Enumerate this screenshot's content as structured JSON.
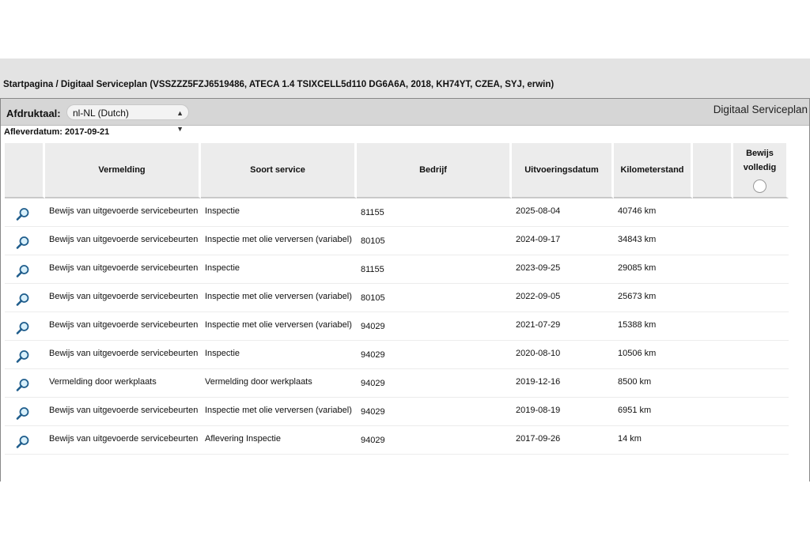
{
  "breadcrumb": "Startpagina / Digitaal Serviceplan (VSSZZZ5FZJ6519486, ATECA 1.4 TSIXCELL5d110 DG6A6A, 2018, KH74YT, CZEA, SYJ, erwin)",
  "toolbar": {
    "language_label": "Afdruktaal:",
    "language_value": "nl-NL (Dutch)",
    "panel_title": "Digitaal Serviceplan"
  },
  "delivery_date": "Afleverdatum: 2017-09-21",
  "table": {
    "headers": {
      "vermelding": "Vermelding",
      "soort": "Soort service",
      "bedrijf": "Bedrijf",
      "datum": "Uitvoeringsdatum",
      "km": "Kilometerstand",
      "bewijs": "Bewijs volledig"
    },
    "rows": [
      {
        "vermelding": "Bewijs van uitgevoerde servicebeurten",
        "soort": "Inspectie",
        "bedrijf": "81155",
        "datum": "2025-08-04",
        "km": "40746 km"
      },
      {
        "vermelding": "Bewijs van uitgevoerde servicebeurten",
        "soort": "Inspectie met olie verversen (variabel)",
        "bedrijf": "80105",
        "datum": "2024-09-17",
        "km": "34843 km"
      },
      {
        "vermelding": "Bewijs van uitgevoerde servicebeurten",
        "soort": "Inspectie",
        "bedrijf": "81155",
        "datum": "2023-09-25",
        "km": "29085 km"
      },
      {
        "vermelding": "Bewijs van uitgevoerde servicebeurten",
        "soort": "Inspectie met olie verversen (variabel)",
        "bedrijf": "80105",
        "datum": "2022-09-05",
        "km": "25673 km"
      },
      {
        "vermelding": "Bewijs van uitgevoerde servicebeurten",
        "soort": "Inspectie met olie verversen (variabel)",
        "bedrijf": "94029",
        "datum": "2021-07-29",
        "km": "15388 km"
      },
      {
        "vermelding": "Bewijs van uitgevoerde servicebeurten",
        "soort": "Inspectie",
        "bedrijf": "94029",
        "datum": "2020-08-10",
        "km": "10506 km"
      },
      {
        "vermelding": "Vermelding door werkplaats",
        "soort": "Vermelding door werkplaats",
        "bedrijf": "94029",
        "datum": "2019-12-16",
        "km": "8500 km"
      },
      {
        "vermelding": "Bewijs van uitgevoerde servicebeurten",
        "soort": "Inspectie met olie verversen (variabel)",
        "bedrijf": "94029",
        "datum": "2019-08-19",
        "km": "6951 km"
      },
      {
        "vermelding": "Bewijs van uitgevoerde servicebeurten",
        "soort": "Aflevering Inspectie",
        "bedrijf": "94029",
        "datum": "2017-09-26",
        "km": "14 km"
      }
    ]
  },
  "icons": {
    "row_action": "magnifier-icon",
    "select_arrow": "chevron-updown-icon"
  }
}
